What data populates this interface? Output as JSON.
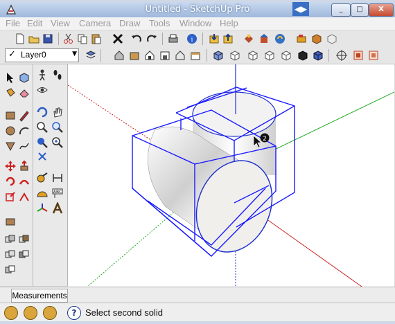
{
  "window": {
    "title": "Untitled - SketchUp Pro",
    "nav_arrows": "◀▶",
    "minimize": "_",
    "maximize": "□",
    "close": "X"
  },
  "menu": [
    "File",
    "Edit",
    "View",
    "Camera",
    "Draw",
    "Tools",
    "Window",
    "Help"
  ],
  "layer": {
    "check": "✓",
    "name": "Layer0",
    "arrow": "▼"
  },
  "measurements": {
    "label": "Measurements"
  },
  "status": {
    "text": "Select second solid"
  },
  "cursor": {
    "badge": "2"
  },
  "colors": {
    "axis_red": "#cc2222",
    "axis_green": "#22aa22",
    "axis_blue": "#2233cc",
    "selection": "#1a1aff",
    "titlebar": "#a9c0e0"
  },
  "icons": {
    "toolbar1": [
      "new-icon",
      "open-icon",
      "save-icon",
      "cut-icon",
      "copy-icon",
      "paste-icon",
      "erase-icon",
      "undo-icon",
      "redo-icon",
      "print-icon",
      "model-info-icon",
      "get-models-icon",
      "share-model-icon",
      "components-icon",
      "extension-warehouse-icon",
      "send-to-layout-icon",
      "tape-icon",
      "cube-icon",
      "cube-icon-2"
    ],
    "toolbar2": [
      "layer-manager-icon",
      "house-icon",
      "house-icon-2",
      "house-icon-3",
      "house-icon-4",
      "house-icon-5",
      "house-icon-6",
      "iso-view-icon",
      "top-view-icon",
      "front-view-icon",
      "right-view-icon",
      "back-view-icon",
      "left-view-icon",
      "shaded-icon",
      "textured-icon",
      "xray-icon",
      "section-icon",
      "section-fill-icon"
    ]
  }
}
